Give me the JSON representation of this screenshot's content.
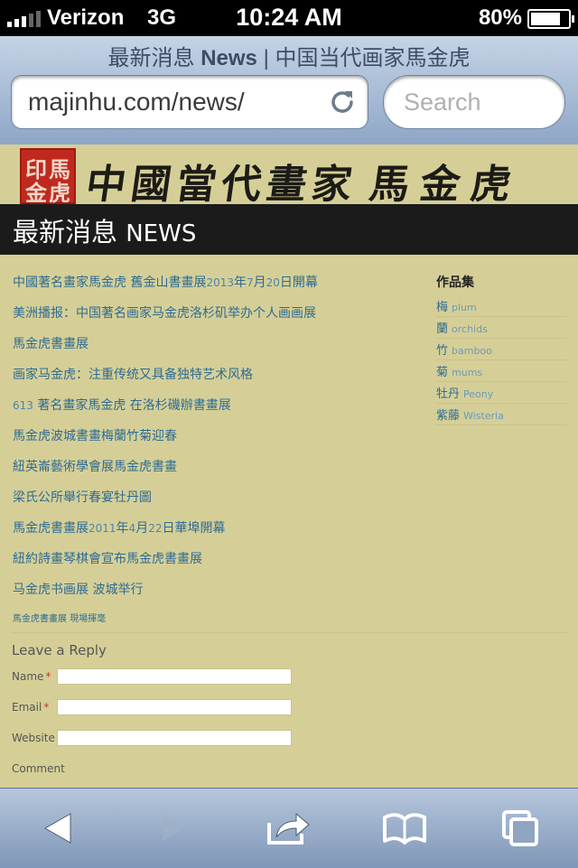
{
  "status": {
    "carrier": "Verizon",
    "network": "3G",
    "time": "10:24 AM",
    "battery": "80%",
    "battery_level": 0.8
  },
  "browser": {
    "title_cn_prefix": "最新消息",
    "title_en": "News",
    "title_suffix": "| 中国当代画家馬金虎",
    "url": "majinhu.com/news/",
    "search_placeholder": "Search"
  },
  "banner": {
    "seal_chars": [
      "馬",
      "金",
      "虎",
      "印"
    ],
    "calligraphy_title": "中國當代畫家",
    "calligraphy_name": "馬金虎"
  },
  "section": {
    "title_cn": "最新消息",
    "title_en": "NEWS"
  },
  "news": [
    {
      "parts": [
        "中國著名畫家馬金虎 舊金山書畫展",
        "2013",
        "年",
        "7",
        "月",
        "20",
        "日開幕"
      ]
    },
    {
      "parts": [
        "美洲播报：中国著名画家马金虎洛杉矶举办个人画画展"
      ]
    },
    {
      "parts": [
        "馬金虎書畫展"
      ]
    },
    {
      "parts": [
        "画家马金虎：注重传统又具备独特艺术风格"
      ]
    },
    {
      "parts": [
        "613",
        " 著名畫家馬金虎 在洛杉磯辦書畫展"
      ]
    },
    {
      "parts": [
        "馬金虎波城書畫梅蘭竹菊迎春"
      ]
    },
    {
      "parts": [
        "紐英崙藝術學會展馬金虎書畫"
      ]
    },
    {
      "parts": [
        "梁氏公所舉行春宴牡丹圖"
      ]
    },
    {
      "parts": [
        "馬金虎書畫展",
        "2011",
        "年",
        "4",
        "月",
        "22",
        "日華埠開幕"
      ]
    },
    {
      "parts": [
        "紐約詩畫琴棋會宣布馬金虎書畫展"
      ]
    },
    {
      "parts": [
        "马金虎书画展 波城举行"
      ]
    },
    {
      "parts": [
        "馬金虎書畫展 現場揮毫"
      ]
    }
  ],
  "sidebar": {
    "heading": "作品集",
    "categories": [
      {
        "cn": "梅",
        "en": "plum"
      },
      {
        "cn": "蘭",
        "en": "orchids"
      },
      {
        "cn": "竹",
        "en": "bamboo"
      },
      {
        "cn": "菊",
        "en": "mums"
      },
      {
        "cn": "牡丹",
        "en": "Peony"
      },
      {
        "cn": "紫藤",
        "en": "Wisteria"
      }
    ]
  },
  "reply": {
    "title": "Leave a Reply",
    "name_label": "Name",
    "email_label": "Email",
    "website_label": "Website",
    "comment_label": "Comment",
    "required_mark": "*"
  },
  "colors": {
    "page_bg": "#d5cf97",
    "link": "#2f6b93",
    "header_bg": "#1b1b1b",
    "toolbar_top": "#c5d4e6",
    "toolbar_bottom": "#8ea6c6"
  }
}
